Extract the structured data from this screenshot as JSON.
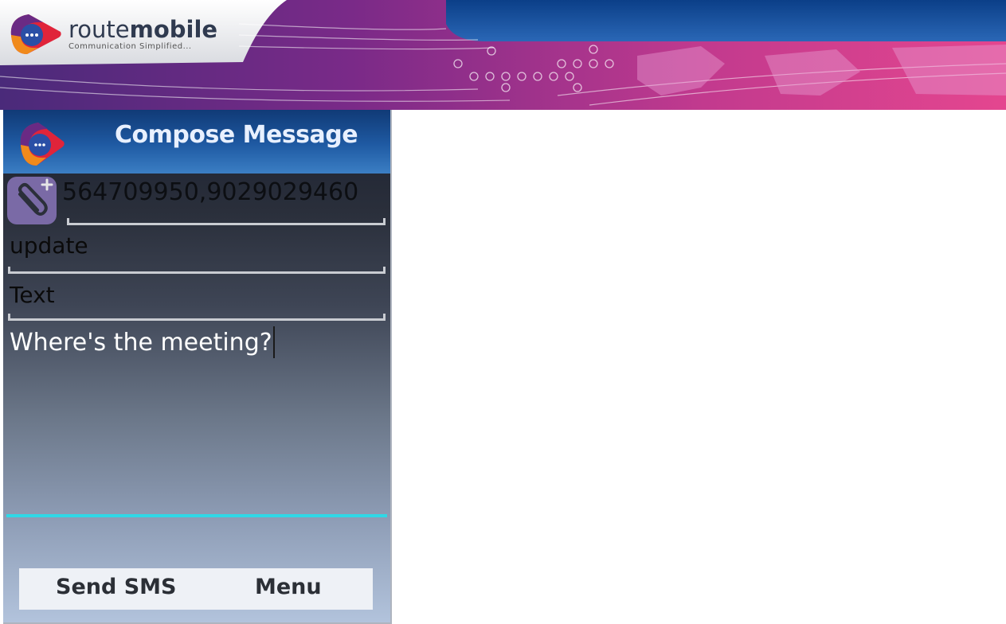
{
  "banner": {
    "brand_light": "route",
    "brand_bold": "mobile",
    "tagline": "Communication Simplified...",
    "colors": {
      "magenta": "#d93f91",
      "purple": "#6a2a84",
      "blue": "#0f4f99"
    }
  },
  "app": {
    "title": "Compose Message",
    "recipients": "564709950,9029029460",
    "subject": "update",
    "type": "Text",
    "message": "Where's the meeting?",
    "softkeys": {
      "left": "Send SMS",
      "right": "Menu"
    }
  },
  "icons": [
    "routemobile-logo-icon",
    "message-bubble-icon",
    "paperclip-add-icon"
  ],
  "accent_color": "#2fd8e6"
}
